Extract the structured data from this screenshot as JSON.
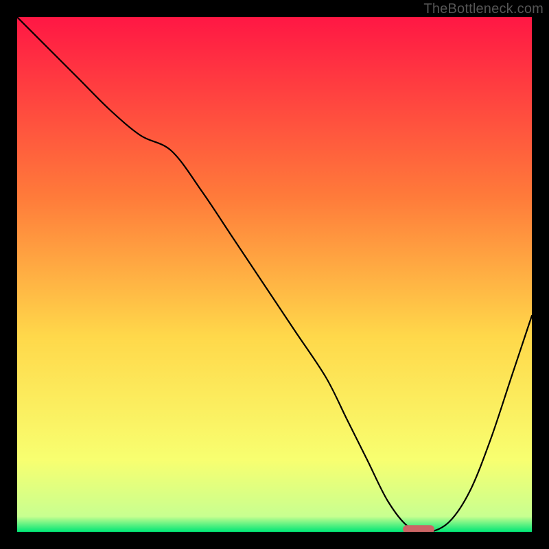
{
  "watermark": "TheBottleneck.com",
  "chart_data": {
    "type": "line",
    "title": "",
    "xlabel": "",
    "ylabel": "",
    "xlim": [
      0,
      100
    ],
    "ylim": [
      0,
      100
    ],
    "background_gradient": {
      "top": "#ff1744",
      "mid_upper": "#ff7b3a",
      "mid": "#ffd84a",
      "lower": "#f8ff70",
      "bottom": "#00e676"
    },
    "series": [
      {
        "name": "bottleneck-curve",
        "x": [
          0,
          6,
          12,
          18,
          24,
          30,
          36,
          42,
          48,
          54,
          60,
          64,
          68,
          72,
          76,
          80,
          84,
          88,
          92,
          96,
          100
        ],
        "y": [
          100,
          94,
          88,
          82,
          77,
          74,
          66,
          57,
          48,
          39,
          30,
          22,
          14,
          6,
          1,
          0,
          2,
          8,
          18,
          30,
          42
        ]
      }
    ],
    "marker": {
      "name": "optimal-marker",
      "x": 78,
      "y": 0.5,
      "color": "#cc6666"
    }
  }
}
